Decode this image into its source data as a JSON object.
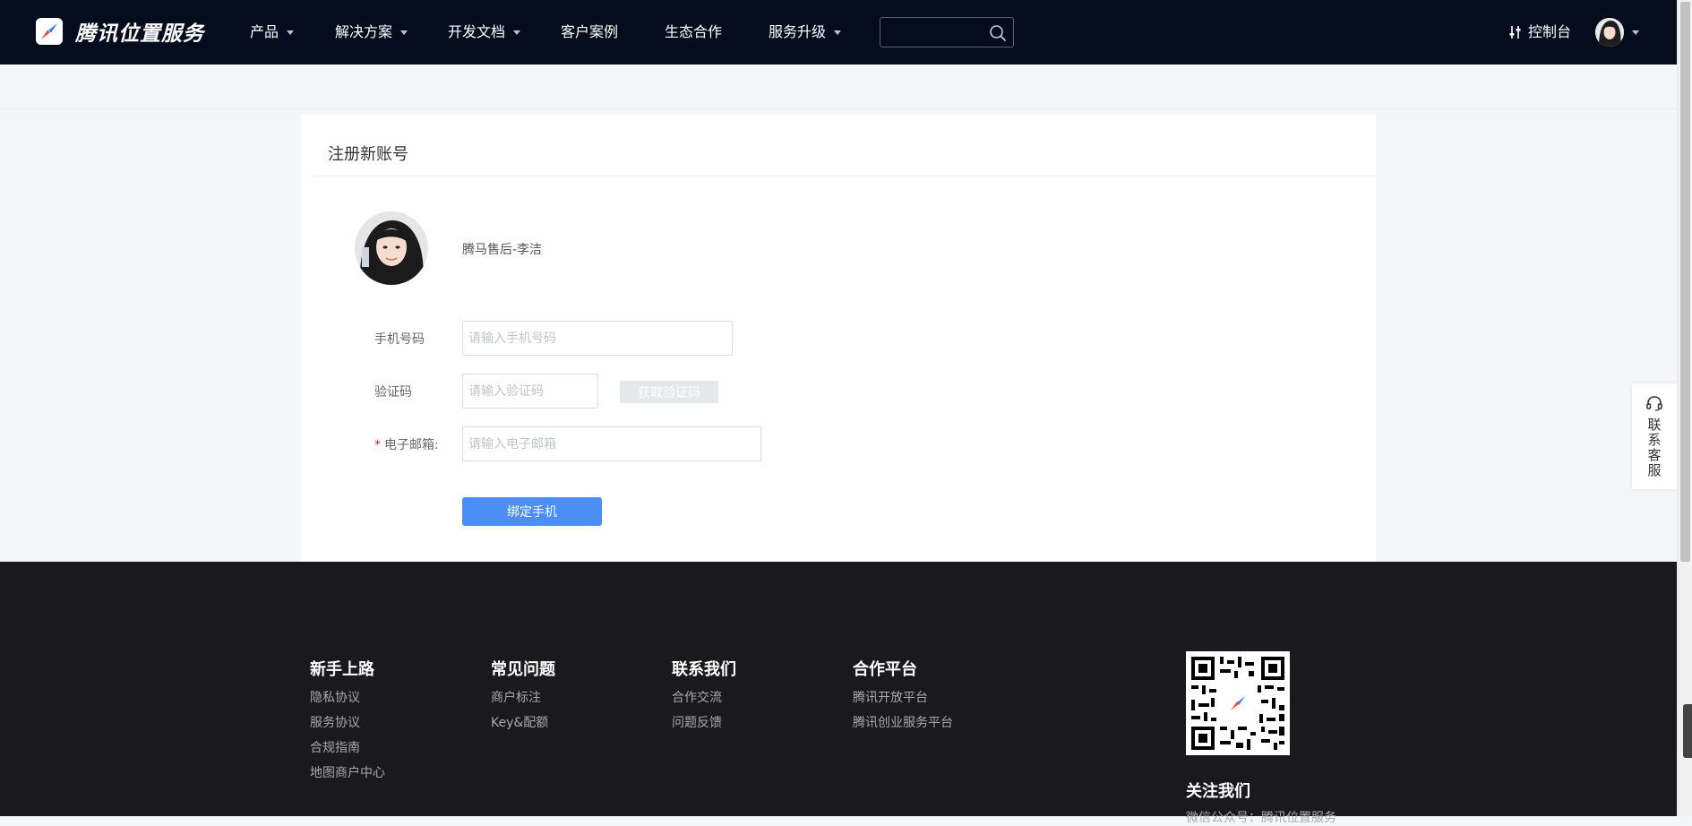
{
  "header": {
    "brand": "腾讯位置服务",
    "nav": [
      {
        "label": "产品",
        "dropdown": true
      },
      {
        "label": "解决方案",
        "dropdown": true
      },
      {
        "label": "开发文档",
        "dropdown": true
      },
      {
        "label": "客户案例",
        "dropdown": false
      },
      {
        "label": "生态合作",
        "dropdown": false
      },
      {
        "label": "服务升级",
        "dropdown": true
      }
    ],
    "search": {
      "value": "",
      "placeholder": ""
    },
    "console_label": "控制台"
  },
  "register": {
    "title": "注册新账号",
    "user_name": "腾马售后-李洁",
    "phone": {
      "label": "手机号码",
      "placeholder": "请输入手机号码",
      "value": ""
    },
    "code": {
      "label": "验证码",
      "placeholder": "请输入验证码",
      "value": "",
      "button": "获取验证码"
    },
    "email": {
      "required_mark": "*",
      "label": "电子邮箱:",
      "placeholder": "请输入电子邮箱",
      "value": ""
    },
    "submit_label": "绑定手机"
  },
  "side_service": {
    "label": "联系客服"
  },
  "footer": {
    "columns": [
      {
        "heading": "新手上路",
        "links": [
          "隐私协议",
          "服务协议",
          "合规指南",
          "地图商户中心"
        ]
      },
      {
        "heading": "常见问题",
        "links": [
          "商户标注",
          "Key&配额"
        ]
      },
      {
        "heading": "联系我们",
        "links": [
          "合作交流",
          "问题反馈"
        ]
      },
      {
        "heading": "合作平台",
        "links": [
          "腾讯开放平台",
          "腾讯创业服务平台"
        ]
      }
    ],
    "follow_title": "关注我们",
    "wechat_text": "微信公众号：腾讯位置服务"
  },
  "colors": {
    "nav_bg": "#040c1d",
    "primary": "#4b8ef4",
    "footer_bg": "#1a1a1d",
    "required": "#e02020"
  },
  "icons": {
    "search": "search-icon",
    "console": "sliders-icon",
    "service": "headset-icon"
  }
}
